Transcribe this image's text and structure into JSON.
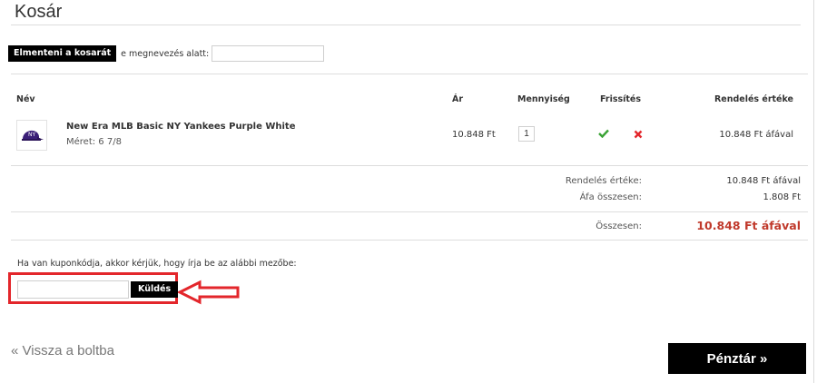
{
  "page": {
    "title": "Kosár"
  },
  "save_cart": {
    "button_label": "Elmenteni a kosarát",
    "name_label": "e megnevezés alatt:",
    "name_value": ""
  },
  "table": {
    "headers": {
      "name": "Név",
      "price": "Ár",
      "quantity": "Mennyiség",
      "update": "Frissítés",
      "order_value": "Rendelés értéke"
    },
    "items": [
      {
        "name": "New Era MLB Basic NY Yankees Purple White",
        "size": "Méret: 6 7/8",
        "price": "10.848 Ft",
        "quantity": "1",
        "total": "10.848 Ft áfával",
        "update_icon": "check-icon",
        "remove_icon": "close-icon"
      }
    ]
  },
  "summary": {
    "order_value_label": "Rendelés értéke:",
    "order_value": "10.848 Ft áfával",
    "vat_label": "Áfa összesen:",
    "vat_value": "1.808 Ft",
    "total_label": "Összesen:",
    "total_value": "10.848 Ft áfával"
  },
  "coupon": {
    "prompt": "Ha van kuponkódja, akkor kérjük, hogy írja be az alábbi mezőbe:",
    "input_value": "",
    "button_label": "Küldés"
  },
  "footer": {
    "back_link": "« Vissza a boltba",
    "checkout_label": "Pénztár »"
  },
  "colors": {
    "accent_black": "#000000",
    "total_red": "#c0392b",
    "highlight_red": "#e3262b",
    "check_green": "#3aa335"
  }
}
